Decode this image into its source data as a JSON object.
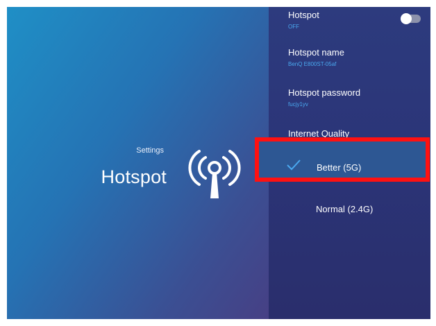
{
  "left": {
    "settings_caption": "Settings",
    "title": "Hotspot",
    "icon": "antenna-broadcast-icon"
  },
  "panel": {
    "hotspot": {
      "label": "Hotspot",
      "status": "OFF",
      "toggle_on": false
    },
    "hotspot_name": {
      "label": "Hotspot name",
      "value": "BenQ E800ST-05af"
    },
    "hotspot_password": {
      "label": "Hotspot password",
      "value": "fucjy1yv"
    },
    "internet_quality": {
      "label": "Internet Quality"
    },
    "options": [
      {
        "label": "Better (5G)",
        "selected": true
      },
      {
        "label": "Normal (2.4G)",
        "selected": false
      }
    ]
  },
  "colors": {
    "highlight_border": "#ff1111",
    "accent_blue": "#4aa9f0",
    "panel_bg": "#2b3578"
  }
}
